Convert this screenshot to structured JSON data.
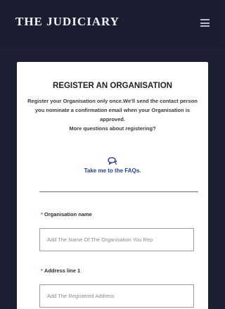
{
  "header": {
    "brand": "THE JUDICIARY",
    "menu_icon": "hamburger-menu-icon"
  },
  "colors": {
    "background": "#1d2033",
    "card": "#ffffff",
    "link": "#25418f",
    "required": "#d13b3b"
  },
  "form": {
    "title": "REGISTER AN ORGANISATION",
    "description": "Register your Organisation only once.We'll send the contact person you nominate a confirmation email when your Organisation is approved.",
    "more_questions": "More questions about registering?",
    "faq_icon": "chat-bubbles-icon",
    "faq_link": "Take me to the FAQs.",
    "fields": [
      {
        "required_mark": "*",
        "label": "Organisation name",
        "placeholder": "Add The Name Of The Organisation You Rep"
      },
      {
        "required_mark": "*",
        "label": "Address line 1",
        "placeholder": "Add The Registered Address"
      }
    ]
  }
}
